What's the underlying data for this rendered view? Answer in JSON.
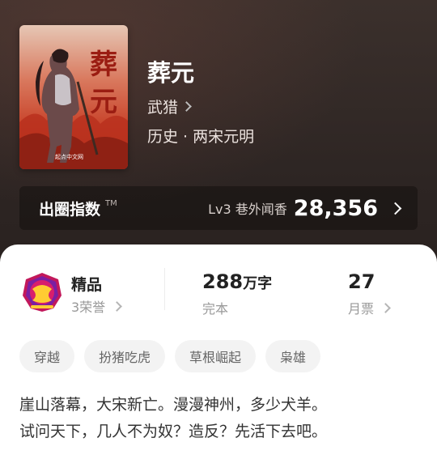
{
  "book": {
    "title": "葬元",
    "author": "武猎",
    "genre": "历史 · 两宋元明",
    "cover": {
      "title_chars": [
        "葬",
        "元"
      ],
      "publisher_mark": "起点中文网"
    }
  },
  "index": {
    "label": "出圈指数",
    "tm": "TM",
    "level": "Lv3 巷外闻香",
    "value": "28,356"
  },
  "stats": {
    "honor": {
      "title": "精品",
      "sub": "3荣誉"
    },
    "words": {
      "value": "288",
      "unit": "万字",
      "label": "完本"
    },
    "tickets": {
      "value": "27",
      "label": "月票"
    }
  },
  "tags": [
    "穿越",
    "扮猪吃虎",
    "草根崛起",
    "枭雄"
  ],
  "synopsis": [
    "崖山落幕，大宋新亡。漫漫神州，多少犬羊。",
    "试问天下，几人不为奴？造反？先活下去吧。"
  ],
  "colors": {
    "hero_bg": "#2c2422",
    "sheet_bg": "#ffffff",
    "tag_bg": "#f3f3f3",
    "badge_accent": "#c2185b"
  },
  "icons": [
    "chevron-right-icon",
    "honor-badge-icon"
  ]
}
